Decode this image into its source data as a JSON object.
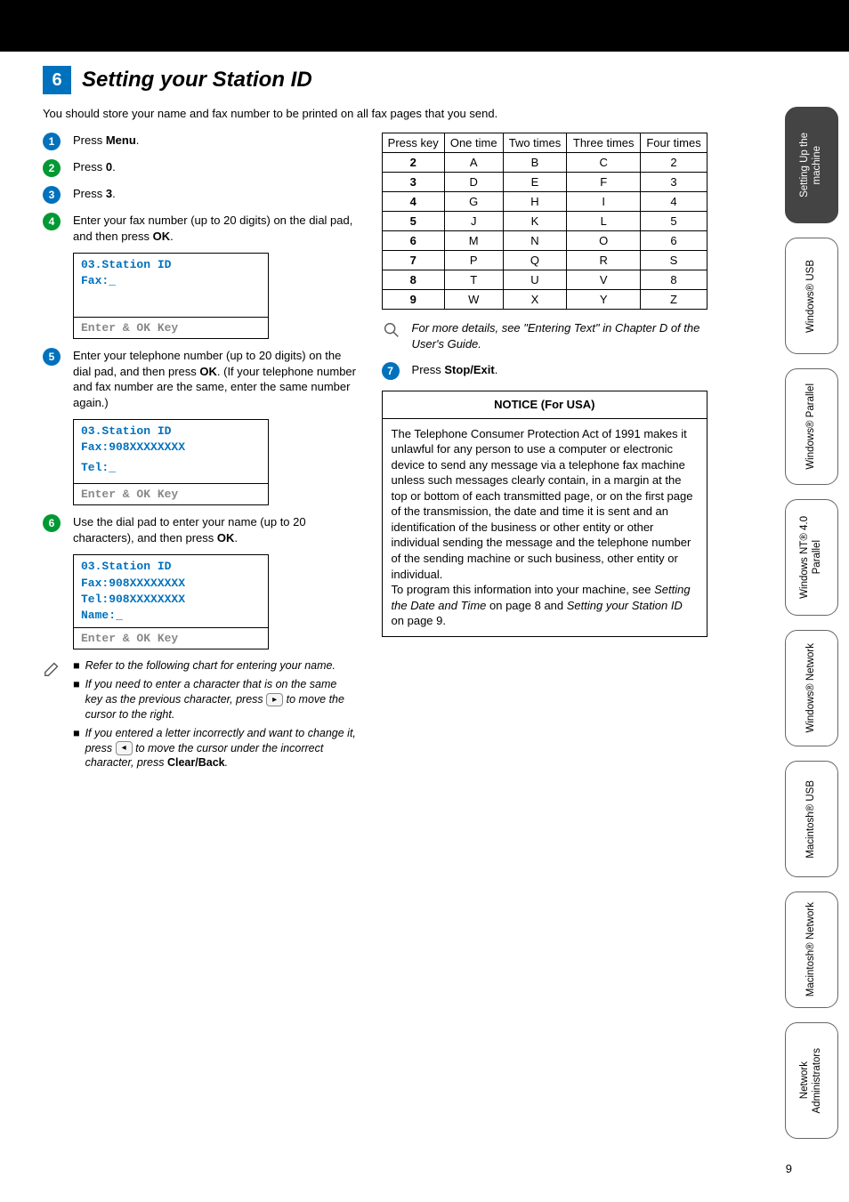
{
  "section": {
    "number": "6",
    "title": "Setting your Station ID"
  },
  "intro": "You should store your name and fax number to be printed on all fax pages that you send.",
  "steps": {
    "s1": "Press ",
    "s1b": "Menu",
    "s1c": ".",
    "s2": "Press ",
    "s2b": "0",
    "s2c": ".",
    "s3": "Press ",
    "s3b": "3",
    "s3c": ".",
    "s4": "Enter your fax number (up to 20 digits) on the dial pad, and then press ",
    "s4b": "OK",
    "s4c": ".",
    "s5": "Enter your telephone number (up to 20 digits) on the dial pad, and then press ",
    "s5b": "OK",
    "s5c": ". (If your telephone number and fax number are the same, enter the same number again.)",
    "s6": "Use the dial pad to enter your name (up to 20 characters), and then press ",
    "s6b": "OK",
    "s6c": ".",
    "s7": "Press ",
    "s7b": "Stop/Exit",
    "s7c": "."
  },
  "lcd1": {
    "l1": "03.Station ID",
    "l2": "",
    "l3": "  Fax:_",
    "bottom": "Enter & OK Key"
  },
  "lcd2": {
    "l1": "03.Station ID",
    "l2": "  Fax:908XXXXXXXX",
    "l3": "  Tel:_",
    "bottom": "Enter & OK Key"
  },
  "lcd3": {
    "l1": "03.Station ID",
    "l2": "  Fax:908XXXXXXXX",
    "l3": "  Tel:908XXXXXXXX",
    "l4": "  Name:_",
    "bottom": "Enter & OK Key"
  },
  "notes": {
    "n1": "Refer to the following chart for entering your name.",
    "n2a": "If you need to enter a character that is on the same key as the previous character, press ",
    "n2b": " to move the cursor to the right.",
    "n3a": "If you entered a letter incorrectly and want to change it, press ",
    "n3b": " to move the cursor under the incorrect character, press ",
    "n3c": "Clear/Back",
    "n3d": "."
  },
  "chart_data": {
    "type": "table",
    "headers": [
      "Press key",
      "One time",
      "Two times",
      "Three times",
      "Four times"
    ],
    "rows": [
      [
        "2",
        "A",
        "B",
        "C",
        "2"
      ],
      [
        "3",
        "D",
        "E",
        "F",
        "3"
      ],
      [
        "4",
        "G",
        "H",
        "I",
        "4"
      ],
      [
        "5",
        "J",
        "K",
        "L",
        "5"
      ],
      [
        "6",
        "M",
        "N",
        "O",
        "6"
      ],
      [
        "7",
        "P",
        "Q",
        "R",
        "S"
      ],
      [
        "8",
        "T",
        "U",
        "V",
        "8"
      ],
      [
        "9",
        "W",
        "X",
        "Y",
        "Z"
      ]
    ]
  },
  "details": "For more details, see \"Entering Text\" in Chapter D of the User's Guide.",
  "notice": {
    "title": "NOTICE (For USA)",
    "p1": "The Telephone Consumer Protection Act of 1991 makes it unlawful for any person to use a computer or electronic device to send any message via a telephone fax machine unless such messages clearly contain, in a margin at the top or bottom of each transmitted page, or on the first page of the transmission, the date and time it is sent and an identification of the business or other entity or other individual sending the message and the telephone number of the sending machine or such business, other entity or individual.",
    "p2a": "To program this information into your machine, see ",
    "p2b": "Setting the Date and Time",
    "p2c": " on page 8 and ",
    "p2d": "Setting your Station ID",
    "p2e": " on page 9."
  },
  "tabs": {
    "t1": "Setting Up\nthe machine",
    "t2": "Windows®\nUSB",
    "t3": "Windows®\nParallel",
    "t4": "Windows\nNT® 4.0\nParallel",
    "t5": "Windows®\nNetwork",
    "t6": "Macintosh®\nUSB",
    "t7": "Macintosh®\nNetwork",
    "t8": "Network\nAdministrators"
  },
  "page": "9"
}
